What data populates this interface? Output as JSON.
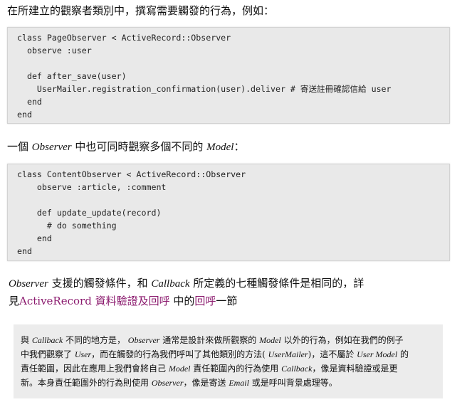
{
  "intro": {
    "text": "在所建立的觀察者類別中，撰寫需要觸發的行為，例如："
  },
  "code_block_1": {
    "lines": [
      "class PageObserver < ActiveRecord::Observer",
      "  observe :user",
      "",
      "  def after_save(user)",
      "    UserMailer.registration_confirmation(user).deliver # 寄送註冊確認信給 user",
      "  end",
      "end"
    ]
  },
  "para2": {
    "p1": "一個 ",
    "observer": "Observer",
    "p2": " 中也可同時觀察多個不同的 ",
    "model": "Model",
    "p3": "："
  },
  "code_block_2": {
    "lines": [
      "class ContentObserver < ActiveRecord::Observer",
      "    observe :article, :comment",
      "",
      "    def update_update(record)",
      "      # do something",
      "    end",
      "end"
    ]
  },
  "para3": {
    "observer": "Observer",
    "p1": " 支援的觸發條件，和 ",
    "callback": "Callback",
    "p2": " 所定義的七種觸發條件是相同的，詳",
    "p3": "見",
    "link1": "ActiveRecord 資料驗證及回呼",
    "p4": " 中的",
    "link2": "回呼",
    "p5": "一節"
  },
  "note": {
    "l1_a": "與 ",
    "l1_callback": "Callback",
    "l1_b": " 不同的地方是， ",
    "l1_observer": "Observer",
    "l1_c": " 通常是設計來做所觀察的 ",
    "l1_model": "Model",
    "l1_d": " 以外的行為，例如在我們的例子",
    "l2_a": "中我們觀察了 ",
    "l2_user": "User",
    "l2_b": "，而在觸發的行為我們呼叫了其他類別的方法( ",
    "l2_mailer": "UserMailer",
    "l2_c": ")，這不屬於 ",
    "l2_usermodel": "User Model",
    "l2_d": " 的",
    "l3_a": "責任範圍，因此在應用上我們會將自己 ",
    "l3_model": "Model",
    "l3_b": " 責任範圍內的行為使用 ",
    "l3_callback": "Callback",
    "l3_c": "，像是資料驗證或是更",
    "l4_a": "新。本身責任範圍外的行為則使用 ",
    "l4_observer": "Observer",
    "l4_b": "，像是寄送 ",
    "l4_email": "Email",
    "l4_c": " 或是呼叫背景處理等。"
  }
}
